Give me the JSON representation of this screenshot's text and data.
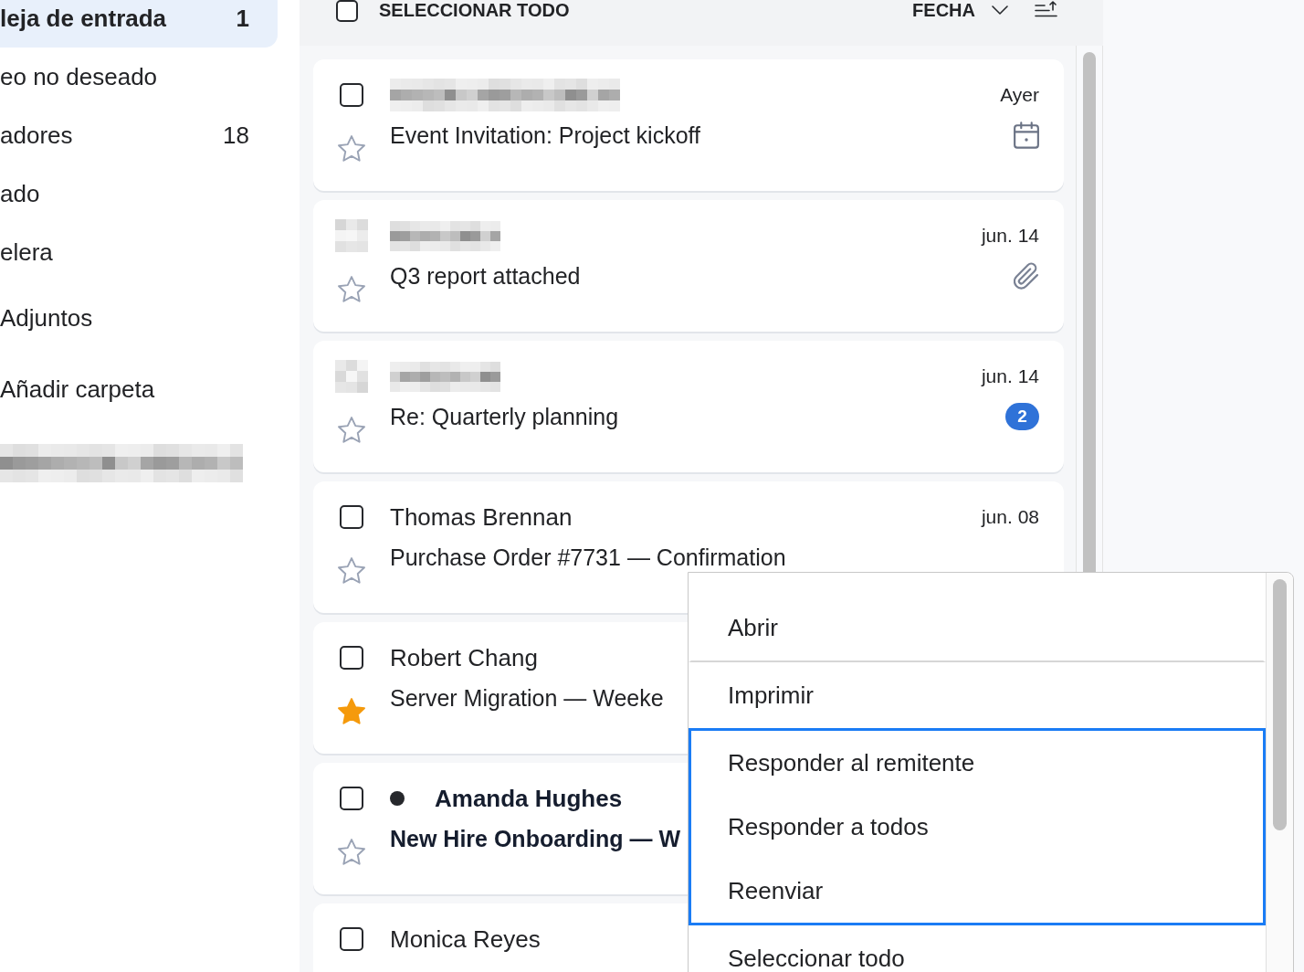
{
  "sidebar": {
    "folders": [
      {
        "label": "leja de entrada",
        "count": "1",
        "selected": true
      },
      {
        "label": "eo no deseado",
        "selected": false
      },
      {
        "label": "adores",
        "count": "18",
        "selected": false
      },
      {
        "label": "ado",
        "selected": false
      },
      {
        "label": "elera",
        "selected": false
      }
    ],
    "views": [
      {
        "label": "Adjuntos",
        "selected": false
      }
    ],
    "add_folder": "Añadir carpeta",
    "account_redacted": true
  },
  "list_header": {
    "select_all": {
      "label": "SELECCIONAR TODO",
      "checked": false
    },
    "sort": {
      "label": "FECHA"
    }
  },
  "emails": [
    {
      "kind": "checkbox",
      "checked": false,
      "starred": false,
      "redacted": true,
      "unread": false,
      "subject": "Event Invitation: Project kickoff",
      "date": "Ayer",
      "invitation": true,
      "attachment": false
    },
    {
      "kind": "avatar",
      "starred": false,
      "redacted": true,
      "unread": false,
      "subject": "Q3 report attached",
      "date": "jun. 14",
      "invitation": false,
      "attachment": true
    },
    {
      "kind": "avatar",
      "starred": false,
      "redacted": true,
      "unread": false,
      "subject": "Re: Quarterly planning",
      "date": "jun. 14",
      "invitation": false,
      "attachment": false,
      "badge": "2"
    },
    {
      "kind": "checkbox",
      "checked": false,
      "starred": false,
      "redacted": false,
      "unread": false,
      "sender": "Thomas Brennan",
      "subject": "Purchase Order #7731 — Confirmation",
      "date": "jun. 08",
      "invitation": false,
      "attachment": false
    },
    {
      "kind": "checkbox",
      "checked": false,
      "starred": true,
      "redacted": false,
      "unread": false,
      "sender": "Robert Chang",
      "subject": "Server Migration — Weeke"
    },
    {
      "kind": "checkbox",
      "checked": false,
      "starred": false,
      "redacted": false,
      "unread": true,
      "sender": "Amanda Hughes",
      "subject": "New Hire Onboarding — W"
    },
    {
      "kind": "checkbox",
      "checked": false,
      "redacted": false,
      "unread": false,
      "sender": "Monica Reyes"
    }
  ],
  "context_menu": {
    "items": [
      {
        "label": "Abrir",
        "focused": false,
        "divider_after": true
      },
      {
        "label": "Imprimir",
        "focused": false,
        "divider_after": false
      },
      {
        "label": "Responder al remitente",
        "focused": true,
        "divider_after": false
      },
      {
        "label": "Responder a todos",
        "focused": true,
        "divider_after": false
      },
      {
        "label": "Reenviar",
        "focused": true,
        "divider_after": false
      },
      {
        "label": "Seleccionar todo",
        "focused": false,
        "divider_after": false
      }
    ]
  }
}
